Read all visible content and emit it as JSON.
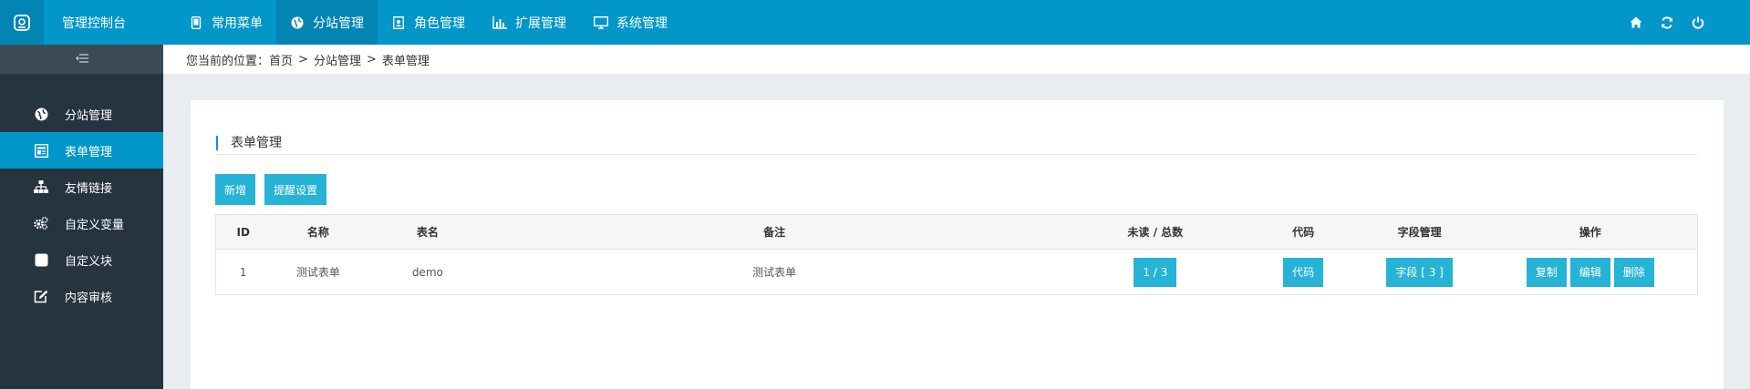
{
  "app": {
    "title": "管理控制台",
    "logo_icon": "dashboard-logo-icon"
  },
  "topnav": [
    {
      "label": "常用菜单",
      "icon": "phone-icon",
      "active": false
    },
    {
      "label": "分站管理",
      "icon": "globe-icon",
      "active": true
    },
    {
      "label": "角色管理",
      "icon": "user-card-icon",
      "active": false
    },
    {
      "label": "扩展管理",
      "icon": "bar-chart-icon",
      "active": false
    },
    {
      "label": "系统管理",
      "icon": "monitor-icon",
      "active": false
    }
  ],
  "topright": [
    "home-icon",
    "refresh-icon",
    "power-icon"
  ],
  "sidebar": {
    "toggle_icon": "menu-collapse-icon",
    "items": [
      {
        "label": "分站管理",
        "icon": "globe-icon",
        "active": false
      },
      {
        "label": "表单管理",
        "icon": "form-icon",
        "active": true
      },
      {
        "label": "友情链接",
        "icon": "sitemap-icon",
        "active": false
      },
      {
        "label": "自定义变量",
        "icon": "gears-icon",
        "active": false
      },
      {
        "label": "自定义块",
        "icon": "square-icon",
        "active": false
      },
      {
        "label": "内容审核",
        "icon": "edit-icon",
        "active": false
      }
    ]
  },
  "breadcrumb": {
    "prefix": "您当前的位置：",
    "home": "首页",
    "level1": "分站管理",
    "level2": "表单管理",
    "sep": ">"
  },
  "panel": {
    "title": "表单管理"
  },
  "buttons": {
    "add": "新增",
    "remind": "提醒设置"
  },
  "table": {
    "headers": {
      "id": "ID",
      "name": "名称",
      "table": "表名",
      "remark": "备注",
      "unread": "未读 / 总数",
      "code": "代码",
      "fields": "字段管理",
      "ops": "操作"
    },
    "rows": [
      {
        "id": "1",
        "name": "测试表单",
        "table": "demo",
        "remark": "测试表单",
        "unread": "1 / 3",
        "code": "代码",
        "fields": "字段 [ 3 ]",
        "op_copy": "复制",
        "op_edit": "编辑",
        "op_delete": "删除"
      }
    ]
  },
  "colors": {
    "primary": "#0396c8",
    "button": "#26b3d6",
    "sidebar": "#263440"
  }
}
